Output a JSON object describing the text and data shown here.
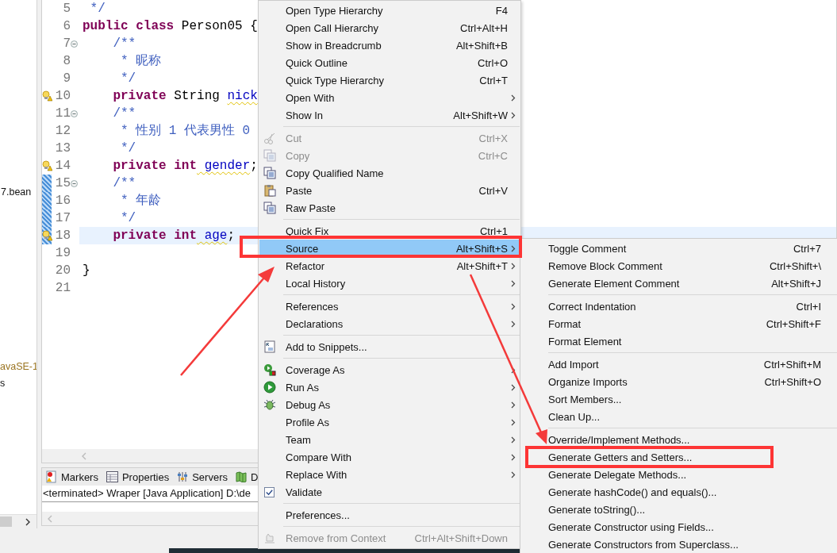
{
  "explorer": {
    "items": [
      {
        "label": "7.bean",
        "kind": "package"
      },
      {
        "label": "avaSE-1",
        "kind": "library"
      },
      {
        "label": "s",
        "kind": "folder"
      }
    ]
  },
  "editor": {
    "lines": [
      {
        "number": "5",
        "current": false,
        "warning": false,
        "foldable": false,
        "changed": false,
        "tokens": [
          {
            "text": " */",
            "kind": "comment"
          }
        ]
      },
      {
        "number": "6",
        "current": false,
        "warning": false,
        "foldable": false,
        "changed": false,
        "tokens": [
          {
            "text": "public",
            "kind": "keyword"
          },
          {
            "text": " class",
            "kind": "keyword"
          },
          {
            "text": " Person05 {",
            "kind": "plain"
          }
        ]
      },
      {
        "number": "7",
        "current": false,
        "warning": false,
        "foldable": true,
        "changed": false,
        "tokens": [
          {
            "text": "    /**",
            "kind": "comment"
          }
        ]
      },
      {
        "number": "8",
        "current": false,
        "warning": false,
        "foldable": false,
        "changed": false,
        "tokens": [
          {
            "text": "     * 昵称",
            "kind": "comment"
          }
        ]
      },
      {
        "number": "9",
        "current": false,
        "warning": false,
        "foldable": false,
        "changed": false,
        "tokens": [
          {
            "text": "     */",
            "kind": "comment"
          }
        ]
      },
      {
        "number": "10",
        "current": false,
        "warning": true,
        "foldable": false,
        "changed": false,
        "tokens": [
          {
            "text": "    private",
            "kind": "keyword"
          },
          {
            "text": " String ",
            "kind": "plain"
          },
          {
            "text": "nick",
            "kind": "field"
          }
        ]
      },
      {
        "number": "11",
        "current": false,
        "warning": false,
        "foldable": true,
        "changed": false,
        "tokens": [
          {
            "text": "    /**",
            "kind": "comment"
          }
        ]
      },
      {
        "number": "12",
        "current": false,
        "warning": false,
        "foldable": false,
        "changed": false,
        "tokens": [
          {
            "text": "     * 性别 1 代表男性 0",
            "kind": "comment"
          }
        ]
      },
      {
        "number": "13",
        "current": false,
        "warning": false,
        "foldable": false,
        "changed": false,
        "tokens": [
          {
            "text": "     */",
            "kind": "comment"
          }
        ]
      },
      {
        "number": "14",
        "current": false,
        "warning": true,
        "foldable": false,
        "changed": false,
        "tokens": [
          {
            "text": "    private int",
            "kind": "keyword"
          },
          {
            "text": " gender",
            "kind": "field"
          },
          {
            "text": ";",
            "kind": "plain"
          }
        ]
      },
      {
        "number": "15",
        "current": false,
        "warning": false,
        "foldable": true,
        "changed": true,
        "tokens": [
          {
            "text": "    /**",
            "kind": "comment"
          }
        ]
      },
      {
        "number": "16",
        "current": false,
        "warning": false,
        "foldable": false,
        "changed": true,
        "tokens": [
          {
            "text": "     * 年龄",
            "kind": "comment"
          }
        ]
      },
      {
        "number": "17",
        "current": false,
        "warning": false,
        "foldable": false,
        "changed": true,
        "tokens": [
          {
            "text": "     */",
            "kind": "comment"
          }
        ]
      },
      {
        "number": "18",
        "current": true,
        "warning": true,
        "foldable": false,
        "changed": true,
        "tokens": [
          {
            "text": "    private int",
            "kind": "keyword"
          },
          {
            "text": " age",
            "kind": "field"
          },
          {
            "text": ";",
            "kind": "plain"
          }
        ]
      },
      {
        "number": "19",
        "current": false,
        "warning": false,
        "foldable": false,
        "changed": false
      },
      {
        "number": "20",
        "current": false,
        "warning": false,
        "foldable": false,
        "changed": false,
        "tokens": [
          {
            "text": "}",
            "kind": "plain"
          }
        ]
      },
      {
        "number": "21",
        "current": false,
        "warning": false,
        "foldable": false,
        "changed": false
      }
    ]
  },
  "bottom_panel": {
    "tabs": [
      {
        "label": "Markers",
        "selected": false
      },
      {
        "label": "Properties",
        "selected": false
      },
      {
        "label": "Servers",
        "selected": false
      },
      {
        "label": "D",
        "selected": false
      }
    ],
    "console_title": "<terminated> Wraper [Java Application] D:\\de"
  },
  "context_menu": {
    "items": [
      {
        "kind": "item",
        "label": "Open Type Hierarchy",
        "shortcut": "F4",
        "submenu": false,
        "disabled": false,
        "selected": false
      },
      {
        "kind": "item",
        "label": "Open Call Hierarchy",
        "shortcut": "Ctrl+Alt+H",
        "submenu": false,
        "disabled": false,
        "selected": false
      },
      {
        "kind": "item",
        "label": "Show in Breadcrumb",
        "shortcut": "Alt+Shift+B",
        "submenu": false,
        "disabled": false,
        "selected": false
      },
      {
        "kind": "item",
        "label": "Quick Outline",
        "shortcut": "Ctrl+O",
        "submenu": false,
        "disabled": false,
        "selected": false
      },
      {
        "kind": "item",
        "label": "Quick Type Hierarchy",
        "shortcut": "Ctrl+T",
        "submenu": false,
        "disabled": false,
        "selected": false
      },
      {
        "kind": "item",
        "label": "Open With",
        "submenu": true,
        "disabled": false,
        "selected": false
      },
      {
        "kind": "item",
        "label": "Show In",
        "shortcut": "Alt+Shift+W",
        "submenu": true,
        "disabled": false,
        "selected": false
      },
      {
        "kind": "separator"
      },
      {
        "kind": "item",
        "label": "Cut",
        "shortcut": "Ctrl+X",
        "submenu": false,
        "disabled": true,
        "selected": false
      },
      {
        "kind": "item",
        "label": "Copy",
        "shortcut": "Ctrl+C",
        "submenu": false,
        "disabled": true,
        "selected": false
      },
      {
        "kind": "item",
        "label": "Copy Qualified Name",
        "submenu": false,
        "disabled": false,
        "selected": false
      },
      {
        "kind": "item",
        "label": "Paste",
        "shortcut": "Ctrl+V",
        "submenu": false,
        "disabled": false,
        "selected": false
      },
      {
        "kind": "item",
        "label": "Raw Paste",
        "submenu": false,
        "disabled": false,
        "selected": false
      },
      {
        "kind": "separator"
      },
      {
        "kind": "item",
        "label": "Quick Fix",
        "shortcut": "Ctrl+1",
        "submenu": false,
        "disabled": false,
        "selected": false
      },
      {
        "kind": "item",
        "label": "Source",
        "shortcut": "Alt+Shift+S",
        "submenu": true,
        "disabled": false,
        "selected": true
      },
      {
        "kind": "item",
        "label": "Refactor",
        "shortcut": "Alt+Shift+T",
        "submenu": true,
        "disabled": false,
        "selected": false
      },
      {
        "kind": "item",
        "label": "Local History",
        "submenu": true,
        "disabled": false,
        "selected": false
      },
      {
        "kind": "separator"
      },
      {
        "kind": "item",
        "label": "References",
        "submenu": true,
        "disabled": false,
        "selected": false
      },
      {
        "kind": "item",
        "label": "Declarations",
        "submenu": true,
        "disabled": false,
        "selected": false
      },
      {
        "kind": "separator"
      },
      {
        "kind": "item",
        "label": "Add to Snippets...",
        "submenu": false,
        "disabled": false,
        "selected": false
      },
      {
        "kind": "separator"
      },
      {
        "kind": "item",
        "label": "Coverage As",
        "submenu": true,
        "disabled": false,
        "selected": false
      },
      {
        "kind": "item",
        "label": "Run As",
        "submenu": true,
        "disabled": false,
        "selected": false
      },
      {
        "kind": "item",
        "label": "Debug As",
        "submenu": true,
        "disabled": false,
        "selected": false
      },
      {
        "kind": "item",
        "label": "Profile As",
        "submenu": true,
        "disabled": false,
        "selected": false
      },
      {
        "kind": "item",
        "label": "Team",
        "submenu": true,
        "disabled": false,
        "selected": false
      },
      {
        "kind": "item",
        "label": "Compare With",
        "submenu": true,
        "disabled": false,
        "selected": false
      },
      {
        "kind": "item",
        "label": "Replace With",
        "submenu": true,
        "disabled": false,
        "selected": false
      },
      {
        "kind": "item",
        "label": "Validate",
        "submenu": false,
        "disabled": false,
        "selected": false
      },
      {
        "kind": "separator"
      },
      {
        "kind": "item",
        "label": "Preferences...",
        "submenu": false,
        "disabled": false,
        "selected": false
      },
      {
        "kind": "separator"
      },
      {
        "kind": "item",
        "label": "Remove from Context",
        "shortcut": "Ctrl+Alt+Shift+Down",
        "submenu": false,
        "disabled": true,
        "selected": false
      }
    ]
  },
  "source_submenu": {
    "items": [
      {
        "kind": "item",
        "label": "Toggle Comment",
        "shortcut": "Ctrl+7"
      },
      {
        "kind": "item",
        "label": "Remove Block Comment",
        "shortcut": "Ctrl+Shift+\\"
      },
      {
        "kind": "item",
        "label": "Generate Element Comment",
        "shortcut": "Alt+Shift+J"
      },
      {
        "kind": "separator"
      },
      {
        "kind": "item",
        "label": "Correct Indentation",
        "shortcut": "Ctrl+I"
      },
      {
        "kind": "item",
        "label": "Format",
        "shortcut": "Ctrl+Shift+F"
      },
      {
        "kind": "item",
        "label": "Format Element"
      },
      {
        "kind": "separator"
      },
      {
        "kind": "item",
        "label": "Add Import",
        "shortcut": "Ctrl+Shift+M"
      },
      {
        "kind": "item",
        "label": "Organize Imports",
        "shortcut": "Ctrl+Shift+O"
      },
      {
        "kind": "item",
        "label": "Sort Members..."
      },
      {
        "kind": "item",
        "label": "Clean Up..."
      },
      {
        "kind": "separator"
      },
      {
        "kind": "item",
        "label": "Override/Implement Methods..."
      },
      {
        "kind": "item",
        "label": "Generate Getters and Setters..."
      },
      {
        "kind": "item",
        "label": "Generate Delegate Methods..."
      },
      {
        "kind": "item",
        "label": "Generate hashCode() and equals()..."
      },
      {
        "kind": "item",
        "label": "Generate toString()..."
      },
      {
        "kind": "item",
        "label": "Generate Constructor using Fields..."
      },
      {
        "kind": "item",
        "label": "Generate Constructors from Superclass..."
      }
    ]
  }
}
